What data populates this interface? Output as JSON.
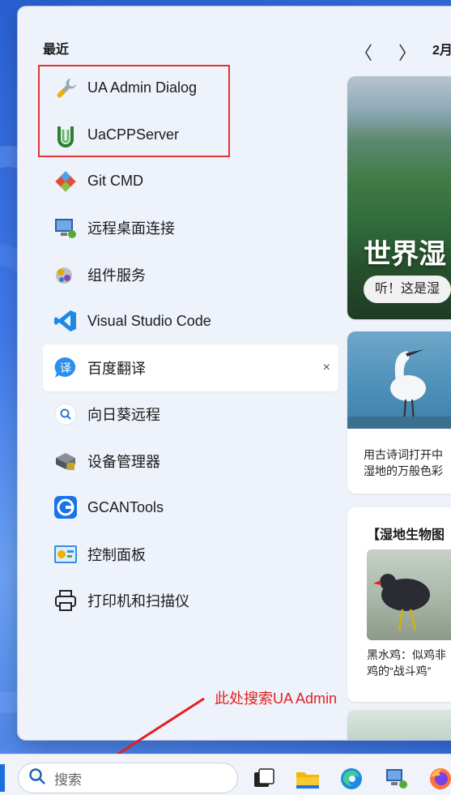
{
  "start_menu": {
    "recent_label": "最近",
    "recent_apps": [
      {
        "label": "UA Admin Dialog",
        "icon": "wrench-icon"
      },
      {
        "label": "UaCPPServer",
        "icon": "uacpp-server-icon"
      },
      {
        "label": "Git CMD",
        "icon": "git-icon"
      },
      {
        "label": "远程桌面连接",
        "icon": "remote-desktop-icon"
      },
      {
        "label": "组件服务",
        "icon": "component-services-icon"
      },
      {
        "label": "Visual Studio Code",
        "icon": "vscode-icon"
      },
      {
        "label": "百度翻译",
        "icon": "baidu-translate-icon"
      },
      {
        "label": "向日葵远程",
        "icon": "sunflower-remote-icon"
      },
      {
        "label": "设备管理器",
        "icon": "device-manager-icon"
      },
      {
        "label": "GCANTools",
        "icon": "gcantools-icon"
      },
      {
        "label": "控制面板",
        "icon": "control-panel-icon"
      },
      {
        "label": "打印机和扫描仪",
        "icon": "printer-icon"
      }
    ],
    "close_glyph": "×"
  },
  "feed": {
    "month": "2月",
    "prev_glyph": "〈",
    "next_glyph": "〉",
    "hero_title": "世界湿",
    "hero_pill": "听！这是湿",
    "egret_text_1": "用古诗词打开中",
    "egret_text_2": "湿地的万般色彩",
    "bird_heading": "【湿地生物图",
    "bird_text_1": "黑水鸡：似鸡非",
    "bird_text_2": "鸡的“战斗鸡”"
  },
  "annotation": {
    "text": "此处搜索UA Admin",
    "color": "#e02020"
  },
  "taskbar": {
    "search_placeholder": "搜索",
    "icons": [
      "task-view-icon",
      "file-explorer-icon",
      "edge-icon",
      "network-app-icon",
      "firefox-icon"
    ]
  }
}
